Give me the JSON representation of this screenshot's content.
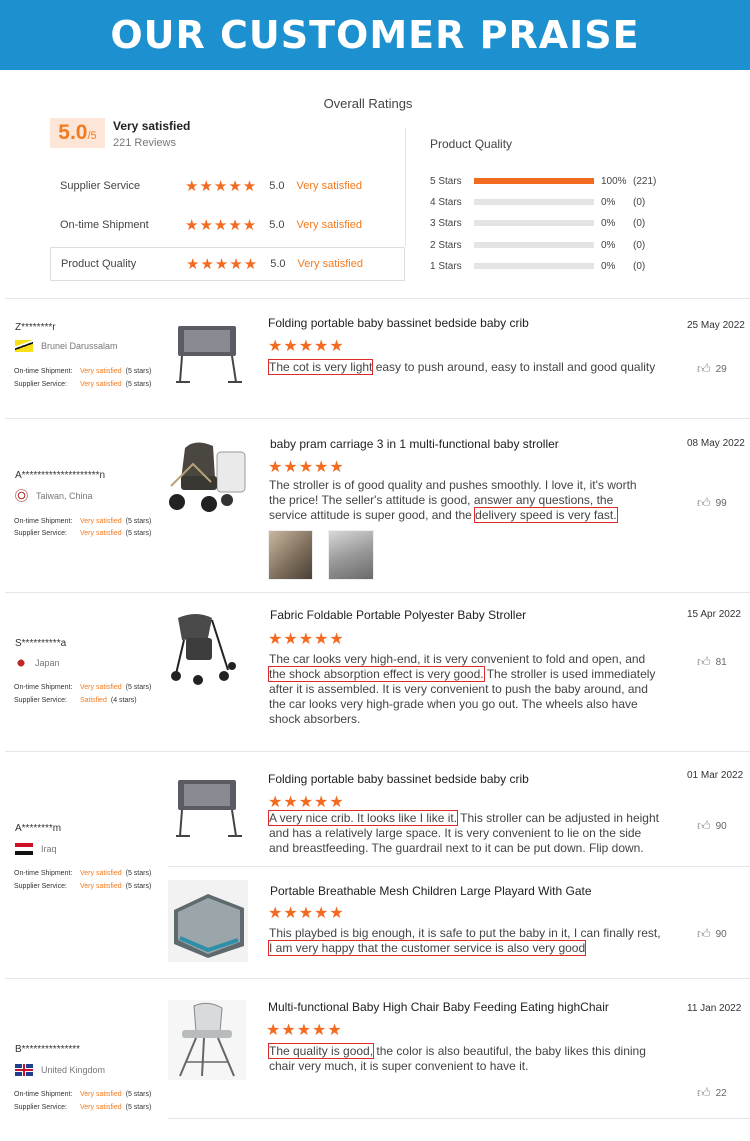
{
  "banner": {
    "title": "OUR CUSTOMER PRAISE"
  },
  "overall": {
    "title": "Overall Ratings",
    "score": "5.0",
    "score_suffix": "/5",
    "satisfied": "Very satisfied",
    "reviews": "221 Reviews",
    "rows": [
      {
        "label": "Supplier Service",
        "stars": "★★★★★",
        "value": "5.0",
        "status": "Very satisfied"
      },
      {
        "label": "On-time Shipment",
        "stars": "★★★★★",
        "value": "5.0",
        "status": "Very satisfied"
      },
      {
        "label": "Product Quality",
        "stars": "★★★★★",
        "value": "5.0",
        "status": "Very satisfied"
      }
    ],
    "product_quality_title": "Product Quality",
    "distribution": [
      {
        "label": "5 Stars",
        "fraction": 1.0,
        "pct": "100%",
        "count": "(221)"
      },
      {
        "label": "4 Stars",
        "fraction": 0,
        "pct": "0%",
        "count": "(0)"
      },
      {
        "label": "3 Stars",
        "fraction": 0,
        "pct": "0%",
        "count": "(0)"
      },
      {
        "label": "2 Stars",
        "fraction": 0,
        "pct": "0%",
        "count": "(0)"
      },
      {
        "label": "1 Stars",
        "fraction": 0,
        "pct": "0%",
        "count": "(0)"
      }
    ]
  },
  "meta_labels": {
    "shipment": "On-time Shipment:",
    "supplier": "Supplier Service:"
  },
  "reviews": [
    {
      "name": "Z********r",
      "country": "Brunei Darussalam",
      "ship_val": "Very satisfied",
      "ship_stars": "(5 stars)",
      "sup_val": "Very satisfied",
      "sup_stars": "(5 stars)",
      "product": "Folding portable baby bassinet bedside baby crib",
      "stars": "★★★★★",
      "text_hl": "The cot is very light",
      "text": " easy to push around, easy to install and good quality",
      "date": "25 May 2022",
      "likes": "29"
    },
    {
      "name": "A********************n",
      "country": "Taiwan, China",
      "ship_val": "Very satisfied",
      "ship_stars": "(5 stars)",
      "sup_val": "Very satisfied",
      "sup_stars": "(5 stars)",
      "product": "baby pram carriage 3 in 1 multi-functional baby stroller",
      "stars": "★★★★★",
      "text": "The stroller is of good quality and pushes smoothly. I love it, it's worth the price! The seller's attitude is good, answer any questions, the service attitude is super good, and the ",
      "text_hl": "delivery speed is very fast.",
      "date": "08 May 2022",
      "likes": "99"
    },
    {
      "name": "S**********a",
      "country": "Japan",
      "ship_val": "Very satisfied",
      "ship_stars": "(5 stars)",
      "sup_val": "Satisfied",
      "sup_stars": "(4 stars)",
      "product": "Fabric Foldable Portable Polyester Baby Stroller",
      "stars": "★★★★★",
      "text_a": "The car looks very high-end, it is very convenient to fold and open, and ",
      "text_hl": "the shock absorption effect is very good.",
      "text_b": " The stroller is used immediately after it is assembled. It is very convenient to push the baby around, and the car looks very high-grade when you go out. The wheels also have shock absorbers.",
      "date": "15 Apr 2022",
      "likes": "81"
    },
    {
      "name": "A********m",
      "country": "Iraq",
      "ship_val": "Very satisfied",
      "ship_stars": "(5 stars)",
      "sup_val": "Very satisfied",
      "sup_stars": "(5 stars)",
      "product": "Folding portable baby bassinet bedside baby crib",
      "stars": "★★★★★",
      "text_hl": "A very nice crib. It looks like I like it.",
      "text": " This stroller can be adjusted in height and has a relatively large space. It is very convenient to lie on the side and breastfeeding. The guardrail next to it can be put down. Flip down.",
      "date": "01 Mar 2022",
      "likes": "90",
      "product2": "Portable Breathable Mesh Children Large Playard With Gate",
      "stars2": "★★★★★",
      "text2": "This playbed is big enough, it is safe to put the baby in it, I can finally rest, ",
      "text2_hl": "I am very happy that the customer service is also very good",
      "likes2": "90"
    },
    {
      "name": "B***************",
      "country": "United Kingdom",
      "ship_val": "Very satisfied",
      "ship_stars": "(5 stars)",
      "sup_val": "Very satisfied",
      "sup_stars": "(5 stars)",
      "product": "Multi-functional Baby High Chair Baby Feeding Eating highChair",
      "stars": "★★★★★",
      "text_hl": "The quality is good,",
      "text": " the color is also beautiful, the baby likes this dining chair very much, it is super convenient to have it.",
      "date": "11 Jan 2022",
      "likes": "22"
    }
  ]
}
